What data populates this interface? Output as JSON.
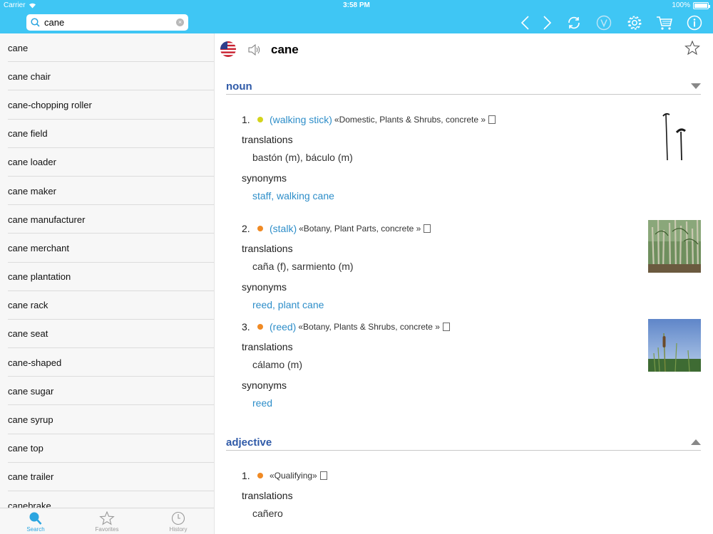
{
  "status": {
    "carrier": "Carrier",
    "time": "3:58 PM",
    "battery": "100%"
  },
  "search": {
    "value": "cane",
    "placeholder": ""
  },
  "toolbar": {
    "icons": [
      "chevron-left-icon",
      "chevron-right-icon",
      "refresh-icon",
      "v-icon",
      "gear-icon",
      "cart-icon",
      "info-icon"
    ]
  },
  "sidebar": {
    "items": [
      "cane",
      "cane chair",
      "cane-chopping roller",
      "cane field",
      "cane loader",
      "cane maker",
      "cane manufacturer",
      "cane merchant",
      "cane plantation",
      "cane rack",
      "cane seat",
      "cane-shaped",
      "cane sugar",
      "cane syrup",
      "cane top",
      "cane trailer",
      "canebrake"
    ]
  },
  "tabs": [
    {
      "label": "Search",
      "active": true
    },
    {
      "label": "Favorites",
      "active": false
    },
    {
      "label": "History",
      "active": false
    }
  ],
  "entry": {
    "headword": "cane",
    "noun": {
      "label": "noun",
      "senses": [
        {
          "num": "1.",
          "dot_color": "#d4d41c",
          "gloss": "(walking stick)",
          "domain": "«Domestic, Plants & Shrubs, concrete »",
          "translations_label": "translations",
          "translations": "bastón (m), báculo (m)",
          "synonyms_label": "synonyms",
          "synonyms": "staff, walking cane"
        },
        {
          "num": "2.",
          "dot_color": "#f08a24",
          "gloss": "(stalk)",
          "domain": "«Botany, Plant Parts, concrete »",
          "translations_label": "translations",
          "translations": "caña (f), sarmiento (m)",
          "synonyms_label": "synonyms",
          "synonyms": "reed, plant cane"
        },
        {
          "num": "3.",
          "dot_color": "#f08a24",
          "gloss": "(reed)",
          "domain": "«Botany, Plants & Shrubs, concrete »",
          "translations_label": "translations",
          "translations": "cálamo (m)",
          "synonyms_label": "synonyms",
          "synonyms": "reed"
        }
      ]
    },
    "adjective": {
      "label": "adjective",
      "senses": [
        {
          "num": "1.",
          "dot_color": "#f08a24",
          "gloss": "",
          "domain": "«Qualifying»",
          "translations_label": "translations",
          "translations": "cañero"
        }
      ]
    }
  }
}
